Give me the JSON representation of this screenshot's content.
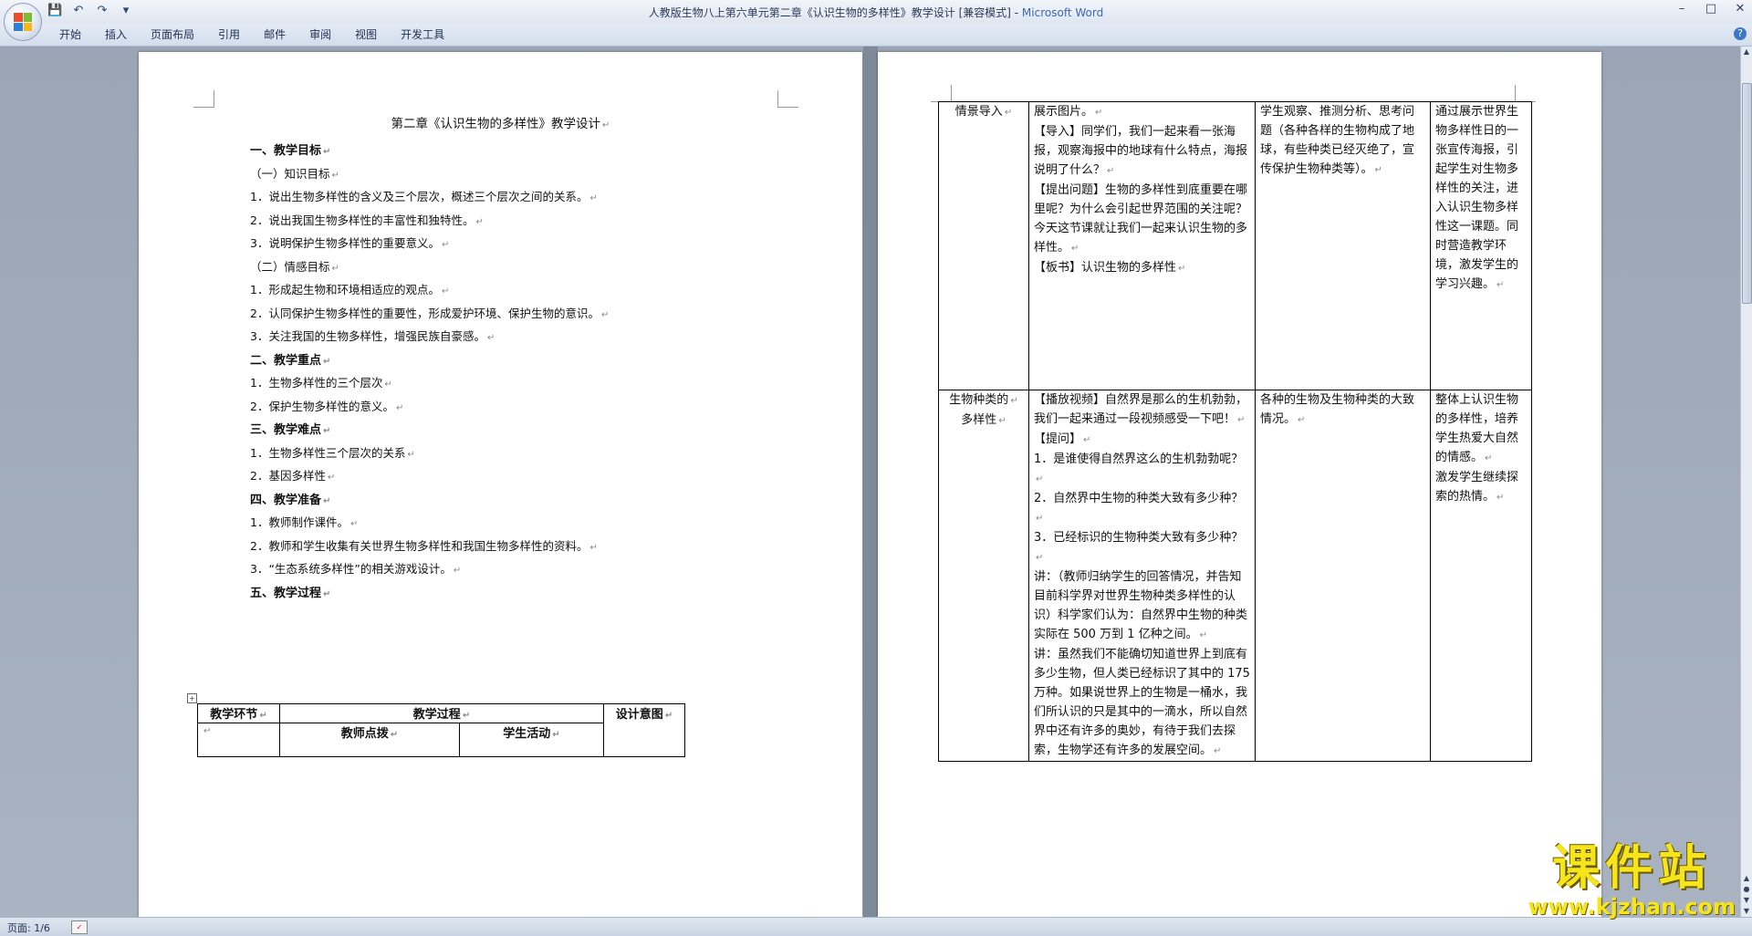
{
  "window": {
    "title": "人教版生物八上第六单元第二章《认识生物的多样性》教学设计 [兼容模式] - ",
    "app_name": "Microsoft Word"
  },
  "quick_access": {
    "icons": [
      "save-icon",
      "undo-icon",
      "redo-icon",
      "customize-icon"
    ]
  },
  "ribbon": {
    "tabs": [
      "开始",
      "插入",
      "页面布局",
      "引用",
      "邮件",
      "审阅",
      "视图",
      "开发工具"
    ]
  },
  "page1": {
    "title": "第二章《认识生物的多样性》教学设计",
    "lines": [
      {
        "text": "一、教学目标",
        "heading": true
      },
      {
        "text": "（一）知识目标",
        "heading": false
      },
      {
        "text": "1．说出生物多样性的含义及三个层次，概述三个层次之间的关系。",
        "heading": false
      },
      {
        "text": "2．说出我国生物多样性的丰富性和独特性。",
        "heading": false
      },
      {
        "text": "3．说明保护生物多样性的重要意义。",
        "heading": false
      },
      {
        "text": "（二）情感目标",
        "heading": false
      },
      {
        "text": "1．形成起生物和环境相适应的观点。",
        "heading": false
      },
      {
        "text": "2．认同保护生物多样性的重要性，形成爱护环境、保护生物的意识。",
        "heading": false
      },
      {
        "text": "3．关注我国的生物多样性，增强民族自豪感。",
        "heading": false
      },
      {
        "text": "二、教学重点",
        "heading": true
      },
      {
        "text": "1．生物多样性的三个层次",
        "heading": false
      },
      {
        "text": "2．保护生物多样性的意义。",
        "heading": false
      },
      {
        "text": "三、教学难点",
        "heading": true
      },
      {
        "text": "1．生物多样性三个层次的关系",
        "heading": false
      },
      {
        "text": "2．基因多样性",
        "heading": false
      },
      {
        "text": "四、教学准备",
        "heading": true
      },
      {
        "text": "1．教师制作课件。",
        "heading": false
      },
      {
        "text": "2．教师和学生收集有关世界生物多样性和我国生物多样性的资料。",
        "heading": false
      },
      {
        "text": "3．“生态系统多样性”的相关游戏设计。",
        "heading": false
      },
      {
        "text": "五、教学过程",
        "heading": true
      }
    ],
    "table": {
      "col1": "教学环节",
      "col2": "教学过程",
      "col2a": "教师点拨",
      "col2b": "学生活动",
      "col3": "设计意图"
    }
  },
  "page2": {
    "rows": [
      {
        "stage": [
          "情景导入"
        ],
        "teacher": [
          "展示图片。",
          "【导入】同学们，我们一起来看一张海报，观察海报中的地球有什么特点，海报说明了什么？",
          "【提出问题】生物的多样性到底重要在哪里呢？为什么会引起世界范围的关注呢？今天这节课就让我们一起来认识生物的多样性。",
          "【板书】认识生物的多样性"
        ],
        "student": [
          "学生观察、推测分析、思考问题（各种各样的生物构成了地球，有些种类已经灭绝了，宣传保护生物种类等）。"
        ],
        "purpose": [
          "通过展示世界生物多样性日的一张宣传海报，引起学生对生物多样性的关注，进入认识生物多样性这一课题。同时营造教学环境，激发学生的学习兴趣。"
        ]
      },
      {
        "stage": [
          "生物种类的",
          "多样性"
        ],
        "teacher": [
          "【播放视频】自然界是那么的生机勃勃，我们一起来通过一段视频感受一下吧！",
          "【提问】",
          "1．是谁使得自然界这么的生机勃勃呢？",
          "2．自然界中生物的种类大致有多少种？",
          "3．已经标识的生物种类大致有多少种？",
          "讲：（教师归纳学生的回答情况，并告知目前科学界对世界生物种类多样性的认识）科学家们认为：自然界中生物的种类实际在 500 万到 1 亿种之间。",
          "讲：虽然我们不能确切知道世界上到底有多少生物，但人类已经标识了其中的 175 万种。如果说世界上的生物是一桶水，我们所认识的只是其中的一滴水，所以自然界中还有许多的奥妙，有待于我们去探索，生物学还有许多的发展空间。"
        ],
        "student": [
          "各种的生物及生物种类的大致情况。"
        ],
        "purpose": [
          "整体上认识生物的多样性，培养学生热爱大自然的情感。",
          "激发学生继续探索的热情。"
        ]
      }
    ]
  },
  "status": {
    "page": "页面: 1/6"
  },
  "watermark": {
    "cn": "课件站",
    "url": "www.kjzhan.com"
  }
}
